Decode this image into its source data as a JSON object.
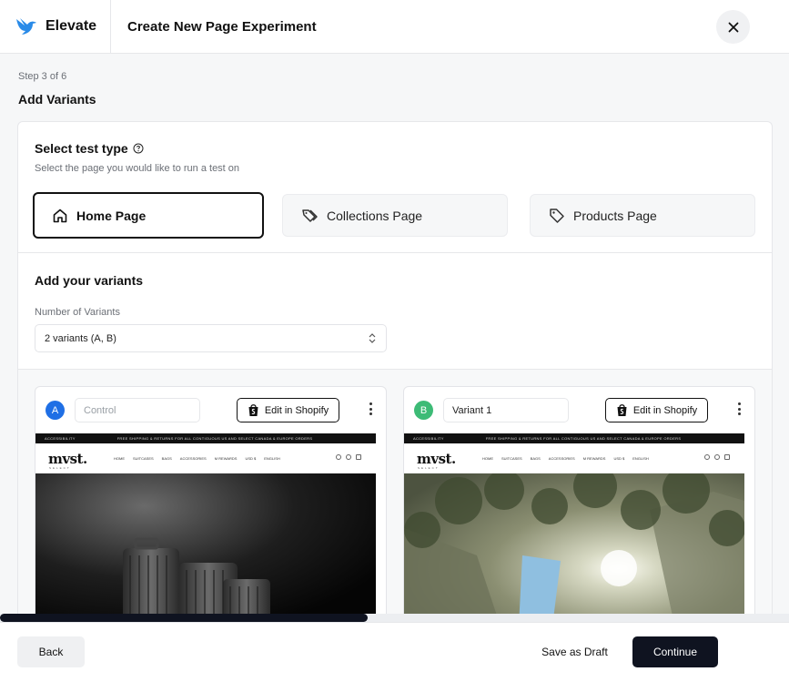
{
  "header": {
    "brand": "Elevate",
    "title": "Create New Page Experiment",
    "close_icon": "close-icon"
  },
  "wizard": {
    "step": "Step 3 of 6",
    "section_title": "Add Variants"
  },
  "test_type": {
    "title": "Select test type",
    "subtitle": "Select the page you would like to run a test on",
    "options": [
      {
        "label": "Home Page",
        "icon": "home-icon",
        "selected": true
      },
      {
        "label": "Collections Page",
        "icon": "tags-icon",
        "selected": false
      },
      {
        "label": "Products Page",
        "icon": "tag-icon",
        "selected": false
      }
    ]
  },
  "variants": {
    "title": "Add your variants",
    "count_label": "Number of Variants",
    "count_value": "2 variants (A, B)",
    "items": [
      {
        "badge": "A",
        "badge_color": "#1f6fe5",
        "name_value": "",
        "name_placeholder": "Control",
        "edit_label": "Edit in Shopify"
      },
      {
        "badge": "B",
        "badge_color": "#3dbb76",
        "name_value": "Variant 1",
        "name_placeholder": "",
        "edit_label": "Edit in Shopify"
      }
    ],
    "preview": {
      "topbar_left": "ACCESSIBILITY",
      "topbar_mid": "FREE SHIPPING & RETURNS FOR ALL CONTIGUOUS US AND SELECT CANADA & EUROPE ORDERS",
      "logo": "mvst.",
      "logo_sub": "SELECT",
      "nav": [
        "HOME",
        "SUITCASES",
        "BAGS",
        "ACCESSORIES",
        "M REWARDS",
        "USD $",
        "ENGLISH"
      ]
    }
  },
  "footer": {
    "back": "Back",
    "save_draft": "Save as Draft",
    "continue": "Continue"
  },
  "colors": {
    "primary_dark": "#0f1320",
    "badge_a": "#1f6fe5",
    "badge_b": "#3dbb76",
    "brand_bird": "#2a8be8"
  }
}
